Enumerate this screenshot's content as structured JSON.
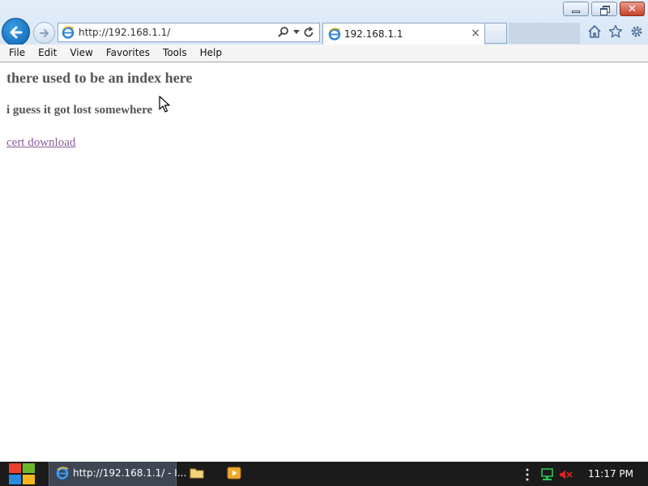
{
  "window": {
    "controls": [
      "minimize-icon",
      "restore-icon",
      "close-icon"
    ]
  },
  "navigation": {
    "address": "http://192.168.1.1/",
    "back_icon": "back-arrow-icon",
    "forward_icon": "forward-arrow-icon"
  },
  "tabs": [
    {
      "label": "192.168.1.1",
      "close": "×"
    }
  ],
  "toolbar_icons": [
    "home-icon",
    "favorites-star-icon",
    "settings-gear-icon"
  ],
  "menu": [
    "File",
    "Edit",
    "View",
    "Favorites",
    "Tools",
    "Help"
  ],
  "page": {
    "heading": "there used to be an index here",
    "subheading": "i guess it got lost somewhere",
    "link": "cert download",
    "link_color": "#8b5e9b",
    "text_color": "#555555"
  },
  "taskbar": {
    "ie_task_label": "http://192.168.1.1/ - I...",
    "clock": "11:17 PM",
    "tray_icons": [
      "overflow-icon",
      "network-icon",
      "volume-muted-icon"
    ],
    "pinned": [
      "file-explorer-icon",
      "media-player-icon"
    ]
  }
}
